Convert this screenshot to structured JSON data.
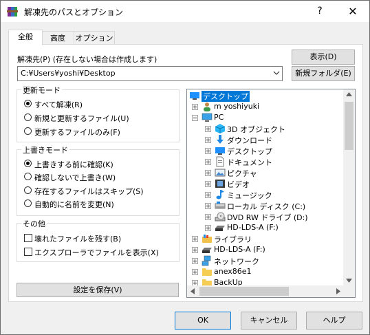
{
  "window": {
    "title": "解凍先のパスとオプション",
    "help_label": "?",
    "close_label": "✕"
  },
  "tabs": [
    {
      "label": "全般",
      "active": true
    },
    {
      "label": "高度",
      "active": false
    },
    {
      "label": "オプション",
      "active": false
    }
  ],
  "destination": {
    "label": "解凍先(P) (存在しない場合は作成します)",
    "path_value": "C:¥Users¥yoshi¥Desktop",
    "show_button": "表示(D)",
    "new_folder_button": "新規フォルダ(E)"
  },
  "update_mode": {
    "title": "更新モード",
    "options": [
      {
        "label": "すべて解凍(R)",
        "selected": true
      },
      {
        "label": "新規と更新するファイル(U)",
        "selected": false
      },
      {
        "label": "更新するファイルのみ(F)",
        "selected": false
      }
    ]
  },
  "overwrite_mode": {
    "title": "上書きモード",
    "options": [
      {
        "label": "上書きする前に確認(K)",
        "selected": true
      },
      {
        "label": "確認しないで上書き(W)",
        "selected": false
      },
      {
        "label": "存在するファイルはスキップ(S)",
        "selected": false
      },
      {
        "label": "自動的に名前を変更(N)",
        "selected": false
      }
    ]
  },
  "misc": {
    "title": "その他",
    "options": [
      {
        "label": "壊れたファイルを残す(B)",
        "checked": false
      },
      {
        "label": "エクスプローラでファイルを表示(X)",
        "checked": false
      }
    ]
  },
  "save_settings_button": "設定を保存(V)",
  "tree": {
    "items": [
      {
        "label": "デスクトップ",
        "icon": "desktop-icon",
        "selected": true
      },
      {
        "label": "m yoshiyuki",
        "icon": "user-icon"
      },
      {
        "label": "PC",
        "icon": "pc-icon"
      },
      {
        "label": "3D オブジェクト",
        "icon": "3d-objects-icon"
      },
      {
        "label": "ダウンロード",
        "icon": "download-icon"
      },
      {
        "label": "デスクトップ",
        "icon": "desktop-icon"
      },
      {
        "label": "ドキュメント",
        "icon": "document-icon"
      },
      {
        "label": "ピクチャ",
        "icon": "pictures-icon"
      },
      {
        "label": "ビデオ",
        "icon": "video-icon"
      },
      {
        "label": "ミュージック",
        "icon": "music-icon"
      },
      {
        "label": "ローカル ディスク (C:)",
        "icon": "disk-icon"
      },
      {
        "label": "DVD RW ドライブ (D:)",
        "icon": "dvd-icon"
      },
      {
        "label": "HD-LDS-A (F:)",
        "icon": "drive-icon"
      },
      {
        "label": "ライブラリ",
        "icon": "library-icon"
      },
      {
        "label": "HD-LDS-A (F:)",
        "icon": "drive-icon"
      },
      {
        "label": "ネットワーク",
        "icon": "network-icon"
      },
      {
        "label": "anex86e1",
        "icon": "folder-icon"
      },
      {
        "label": "BackUp",
        "icon": "folder-icon"
      }
    ]
  },
  "footer": {
    "ok": "OK",
    "cancel": "キャンセル",
    "help": "ヘルプ"
  },
  "colors": {
    "selection": "#0078d7",
    "button_face": "#e1e1e1",
    "dialog_bg": "#f0f0f0"
  }
}
